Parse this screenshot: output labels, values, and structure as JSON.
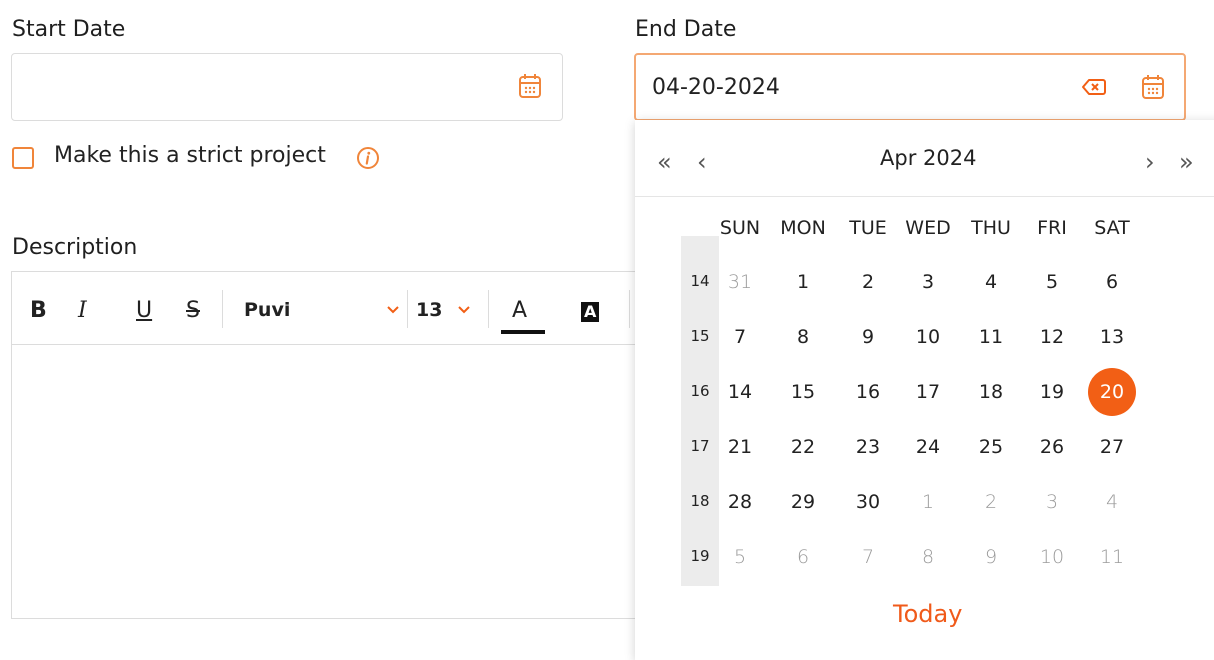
{
  "start_date": {
    "label": "Start Date",
    "value": ""
  },
  "end_date": {
    "label": "End Date",
    "value": "04-20-2024"
  },
  "strict_project": {
    "label": "Make this a strict project",
    "checked": false
  },
  "description": {
    "label": "Description",
    "toolbar": {
      "bold": "B",
      "italic": "I",
      "underline": "U",
      "strike": "S",
      "font": "Puvi",
      "size": "13",
      "text_color": "A",
      "bg_color": "A"
    }
  },
  "calendar": {
    "month_label": "Apr 2024",
    "prev_year": "«",
    "prev_month": "‹",
    "next_month": "›",
    "next_year": "»",
    "weekdays": [
      "SUN",
      "MON",
      "TUE",
      "WED",
      "THU",
      "FRI",
      "SAT"
    ],
    "weeks": [
      {
        "num": "14",
        "days": [
          {
            "d": "31",
            "m": true
          },
          {
            "d": "1"
          },
          {
            "d": "2"
          },
          {
            "d": "3"
          },
          {
            "d": "4"
          },
          {
            "d": "5"
          },
          {
            "d": "6"
          }
        ]
      },
      {
        "num": "15",
        "days": [
          {
            "d": "7"
          },
          {
            "d": "8"
          },
          {
            "d": "9"
          },
          {
            "d": "10"
          },
          {
            "d": "11"
          },
          {
            "d": "12"
          },
          {
            "d": "13"
          }
        ]
      },
      {
        "num": "16",
        "days": [
          {
            "d": "14"
          },
          {
            "d": "15"
          },
          {
            "d": "16"
          },
          {
            "d": "17"
          },
          {
            "d": "18"
          },
          {
            "d": "19"
          },
          {
            "d": "20",
            "s": true
          }
        ]
      },
      {
        "num": "17",
        "days": [
          {
            "d": "21"
          },
          {
            "d": "22"
          },
          {
            "d": "23"
          },
          {
            "d": "24"
          },
          {
            "d": "25"
          },
          {
            "d": "26"
          },
          {
            "d": "27"
          }
        ]
      },
      {
        "num": "18",
        "days": [
          {
            "d": "28"
          },
          {
            "d": "29"
          },
          {
            "d": "30"
          },
          {
            "d": "1",
            "m": true
          },
          {
            "d": "2",
            "m": true
          },
          {
            "d": "3",
            "m": true
          },
          {
            "d": "4",
            "m": true
          }
        ]
      },
      {
        "num": "19",
        "days": [
          {
            "d": "5",
            "m": true
          },
          {
            "d": "6",
            "m": true
          },
          {
            "d": "7",
            "m": true
          },
          {
            "d": "8",
            "m": true
          },
          {
            "d": "9",
            "m": true
          },
          {
            "d": "10",
            "m": true
          },
          {
            "d": "11",
            "m": true
          }
        ]
      }
    ],
    "today_label": "Today"
  },
  "colors": {
    "accent": "#f25f15",
    "active_border": "#f4a873"
  }
}
